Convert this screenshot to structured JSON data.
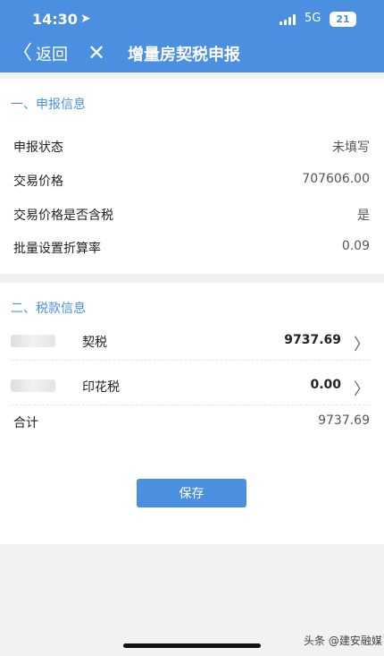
{
  "status_bar": {
    "time": "14:30",
    "network": "5G",
    "battery": "21"
  },
  "nav": {
    "back_label": "返回",
    "title": "增量房契税申报"
  },
  "section1": {
    "title": "一、申报信息",
    "rows": [
      {
        "label": "申报状态",
        "value": "未填写"
      },
      {
        "label": "交易价格",
        "value": "707606.00"
      },
      {
        "label": "交易价格是否含税",
        "value": "是"
      },
      {
        "label": "批量设置折算率",
        "value": "0.09"
      }
    ]
  },
  "section2": {
    "title": "二、税款信息",
    "taxes": [
      {
        "name": "契税",
        "amount": "9737.69"
      },
      {
        "name": "印花税",
        "amount": "0.00"
      }
    ],
    "total_label": "合计",
    "total_value": "9737.69"
  },
  "save_label": "保存",
  "watermark": "头条 @建安融媒"
}
